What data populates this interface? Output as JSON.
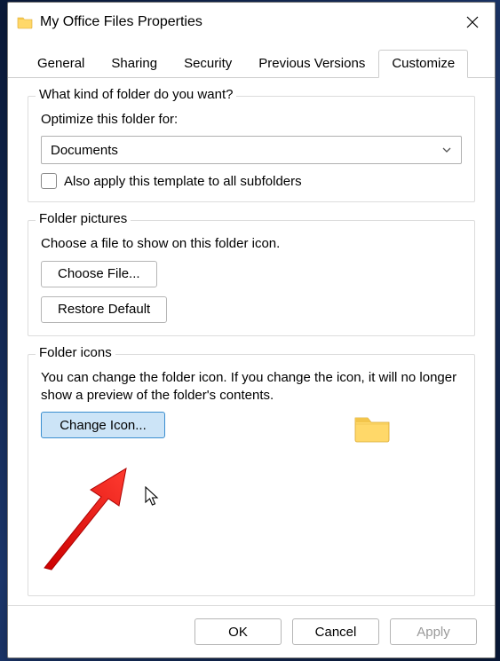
{
  "window": {
    "title": "My Office Files Properties"
  },
  "tabs": {
    "general": "General",
    "sharing": "Sharing",
    "security": "Security",
    "previous": "Previous Versions",
    "customize": "Customize"
  },
  "group_kind": {
    "legend": "What kind of folder do you want?",
    "optimize_label": "Optimize this folder for:",
    "selected": "Documents",
    "also_apply": "Also apply this template to all subfolders"
  },
  "group_pictures": {
    "legend": "Folder pictures",
    "help": "Choose a file to show on this folder icon.",
    "choose": "Choose File...",
    "restore": "Restore Default"
  },
  "group_icons": {
    "legend": "Folder icons",
    "help": "You can change the folder icon. If you change the icon, it will no longer show a preview of the folder's contents.",
    "change": "Change Icon..."
  },
  "footer": {
    "ok": "OK",
    "cancel": "Cancel",
    "apply": "Apply"
  }
}
